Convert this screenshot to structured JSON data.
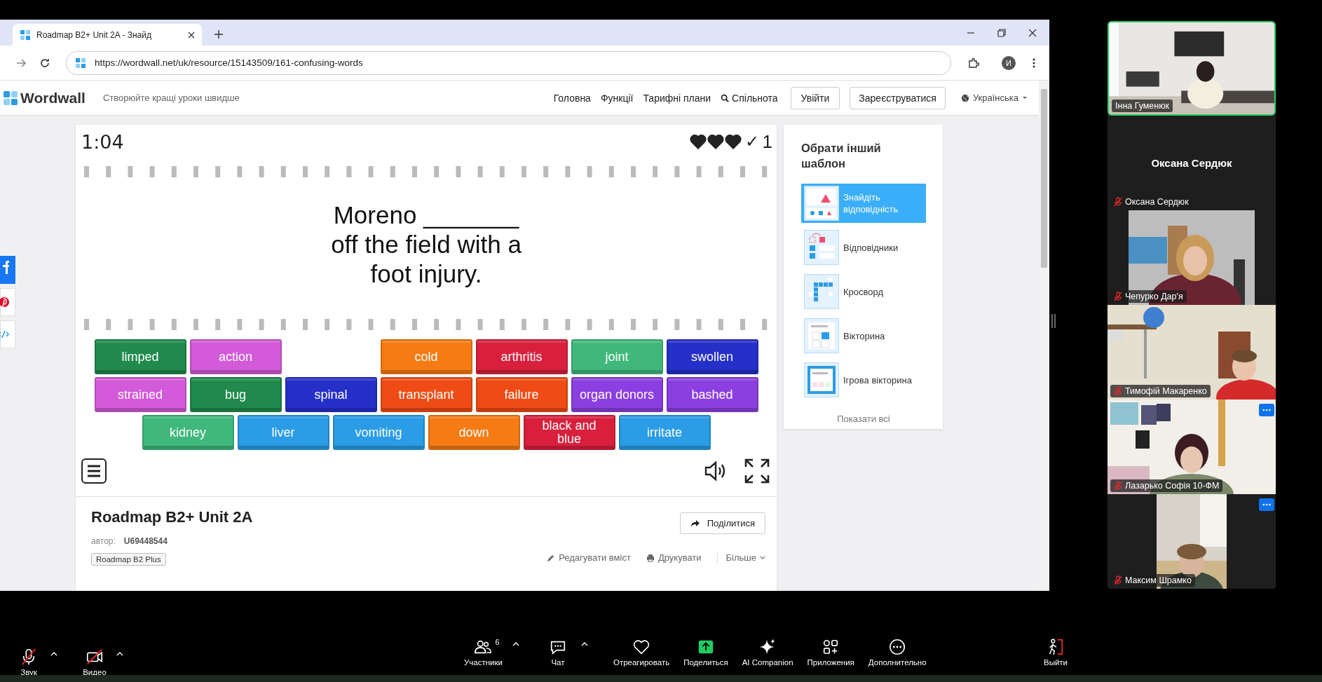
{
  "browser": {
    "tab": {
      "title": "Roadmap B2+ Unit 2A - Знайд",
      "selected": true
    },
    "url": "https://wordwall.net/uk/resource/15143509/161-confusing-words",
    "profile_initial": "И"
  },
  "site_header": {
    "logo": "Wordwall",
    "tagline": "Створюйте кращі уроки швидше",
    "nav": [
      {
        "label": "Головна",
        "kind": "link"
      },
      {
        "label": "Функції",
        "kind": "link"
      },
      {
        "label": "Тарифні плани",
        "kind": "link"
      },
      {
        "label": "Спільнота",
        "kind": "search"
      }
    ],
    "buttons": [
      "Увійти",
      "Зареєструватися"
    ],
    "language": "Українська"
  },
  "game": {
    "timer": "1:04",
    "lives": [
      {
        "filled": true
      },
      {
        "filled": true
      },
      {
        "filled": true
      }
    ],
    "score_mark": "✓",
    "score": "1",
    "question": "Moreno _______ off the field with a foot injury.",
    "tile_rows": [
      [
        {
          "kind": "word",
          "text": "limped",
          "color": "#1f8a4c"
        },
        {
          "kind": "word",
          "text": "action",
          "color": "#d35ad8"
        },
        {
          "kind": "empty"
        },
        {
          "kind": "word",
          "text": "cold",
          "color": "#f67b14"
        },
        {
          "kind": "word",
          "text": "arthritis",
          "color": "#d8203c"
        },
        {
          "kind": "word",
          "text": "joint",
          "color": "#40b87c"
        },
        {
          "kind": "word",
          "text": "swollen",
          "color": "#2530c8"
        }
      ],
      [
        {
          "kind": "word",
          "text": "strained",
          "color": "#d35ad8"
        },
        {
          "kind": "word",
          "text": "bug",
          "color": "#1f8a4c"
        },
        {
          "kind": "word",
          "text": "spinal",
          "color": "#2530c8"
        },
        {
          "kind": "word",
          "text": "transplant",
          "color": "#ee4c14"
        },
        {
          "kind": "word",
          "text": "failure",
          "color": "#ee4c14"
        },
        {
          "kind": "word",
          "text": "organ donors",
          "color": "#8b3fe0"
        },
        {
          "kind": "word",
          "text": "bashed",
          "color": "#8b3fe0"
        }
      ],
      [
        {
          "kind": "word",
          "text": "kidney",
          "color": "#40b87c"
        },
        {
          "kind": "word",
          "text": "liver",
          "color": "#2b9ce6"
        },
        {
          "kind": "word",
          "text": "vomiting",
          "color": "#2b9ce6"
        },
        {
          "kind": "word",
          "text": "down",
          "color": "#f67b14"
        },
        {
          "kind": "word",
          "text": "black and blue",
          "color": "#d8203c"
        },
        {
          "kind": "word",
          "text": "irritate",
          "color": "#2b9ce6"
        }
      ]
    ]
  },
  "activity": {
    "title": "Roadmap B2+ Unit 2A",
    "author_label": "автор:",
    "author": "U69448544",
    "tag": "Roadmap B2 Plus",
    "share_button": "Поділитися",
    "links": [
      {
        "label": "Редагувати вміст",
        "kind": "edit"
      },
      {
        "label": "Друкувати",
        "kind": "print"
      },
      {
        "label": "Більше",
        "kind": "more"
      }
    ]
  },
  "templates": {
    "title": "Обрати інший шаблон",
    "items": [
      {
        "label": "Знайдіть відповідність",
        "selected": true
      },
      {
        "label": "Відповідники",
        "selected": false
      },
      {
        "label": "Кросворд",
        "selected": false
      },
      {
        "label": "Вікторина",
        "selected": false
      },
      {
        "label": "Ігрова вікторина",
        "selected": false
      }
    ],
    "show_all": "Показати всі"
  },
  "participants": [
    {
      "name": "Інна Гуменюк",
      "kind": "video",
      "speaking": true,
      "muted": false,
      "options": false
    },
    {
      "name": "Оксана Сердюк",
      "display_name": "Оксана Сердюк",
      "kind": "no_video",
      "speaking": false,
      "muted": true,
      "options": false
    },
    {
      "name": "Чепурко Дар'я",
      "kind": "portrait_video",
      "speaking": false,
      "muted": true,
      "options": false
    },
    {
      "name": "Тимофій Макаренко",
      "kind": "video",
      "speaking": false,
      "muted": true,
      "options": false
    },
    {
      "name": "Лазарько Софія 10-ФМ",
      "kind": "video",
      "speaking": false,
      "muted": true,
      "options": true
    },
    {
      "name": "Максим Шрамко",
      "kind": "portrait_video",
      "speaking": false,
      "muted": true,
      "options": true
    }
  ],
  "toolbar": {
    "left": [
      {
        "label": "Звук",
        "kind": "mic",
        "off": true,
        "menu": true
      },
      {
        "label": "Видео",
        "kind": "camera",
        "off": true,
        "menu": true
      }
    ],
    "center": [
      {
        "label": "Участники",
        "kind": "participants",
        "count": "6",
        "menu": true
      },
      {
        "label": "Чат",
        "kind": "chat",
        "menu": true
      },
      {
        "label": "Отреагировать",
        "kind": "react"
      },
      {
        "label": "Поделиться",
        "kind": "share"
      },
      {
        "label": "AI Companion",
        "kind": "ai"
      },
      {
        "label": "Приложения",
        "kind": "apps"
      },
      {
        "label": "Дополнительно",
        "kind": "more"
      }
    ],
    "right": [
      {
        "label": "Выйти",
        "kind": "leave"
      }
    ]
  }
}
